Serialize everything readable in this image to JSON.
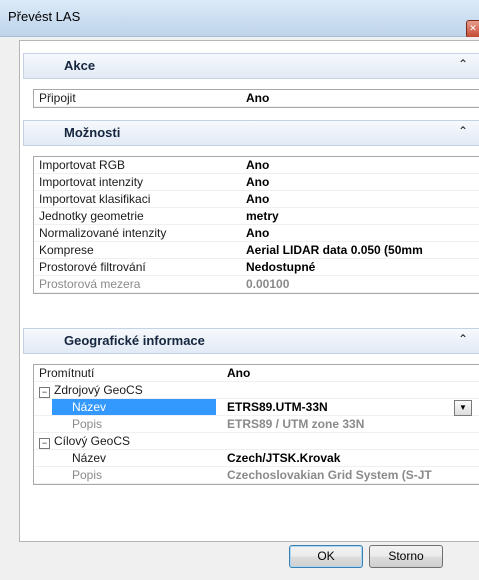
{
  "window": {
    "title": "Převést LAS",
    "close_glyph": "✕"
  },
  "sections": [
    {
      "title": "Akce",
      "rows": [
        {
          "label": "Připojit",
          "value": "Ano"
        }
      ]
    },
    {
      "title": "Možnosti",
      "rows": [
        {
          "label": "Importovat RGB",
          "value": "Ano"
        },
        {
          "label": "Importovat intenzity",
          "value": "Ano"
        },
        {
          "label": "Importovat klasifikaci",
          "value": "Ano"
        },
        {
          "label": "Jednotky geometrie",
          "value": "metry"
        },
        {
          "label": "Normalizované intenzity",
          "value": "Ano"
        },
        {
          "label": "Komprese",
          "value": "Aerial LIDAR data 0.050 (50mm"
        },
        {
          "label": "Prostorové filtrování",
          "value": "Nedostupné"
        },
        {
          "label": "Prostorová mezera",
          "value": "0.00100"
        }
      ]
    },
    {
      "title": "Geografické informace",
      "rows": [
        {
          "label": "Promítnutí",
          "value": "Ano"
        },
        {
          "label": "Zdrojový GeoCS",
          "value": ""
        },
        {
          "label": "Název",
          "value": "ETRS89.UTM-33N"
        },
        {
          "label": "Popis",
          "value": "ETRS89 / UTM zone 33N"
        },
        {
          "label": "Cílový GeoCS",
          "value": ""
        },
        {
          "label": "Název",
          "value": "Czech/JTSK.Krovak"
        },
        {
          "label": "Popis",
          "value": "Czechoslovakian Grid System (S-JT"
        }
      ]
    }
  ],
  "chevron_glyph": "⌃",
  "expander_glyph": "−",
  "dropdown_glyph": "▼",
  "buttons": {
    "ok": "OK",
    "cancel": "Storno"
  }
}
